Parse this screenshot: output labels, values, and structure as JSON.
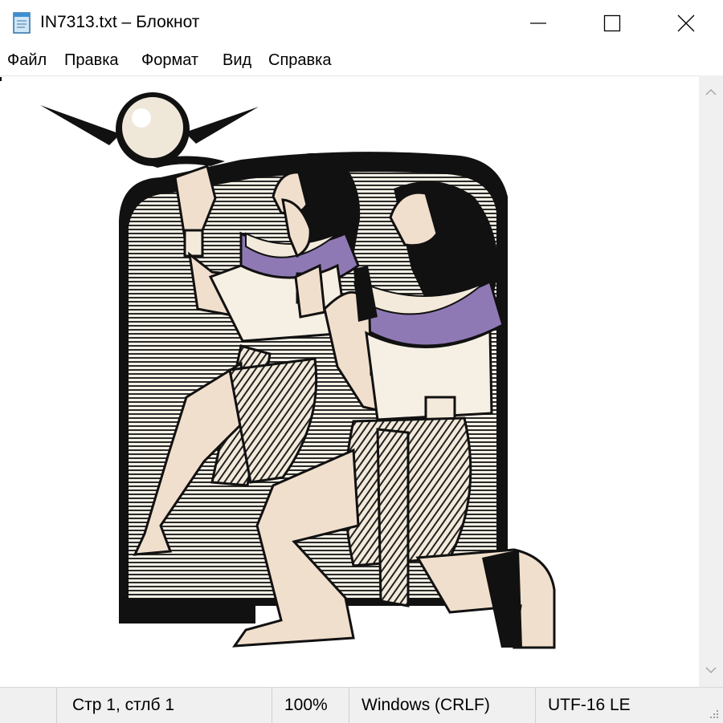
{
  "window": {
    "title": "IN7313.txt – Блокнот",
    "icon": "notepad-icon",
    "controls": [
      "minimize-icon",
      "maximize-icon",
      "close-icon"
    ]
  },
  "menu": {
    "items": [
      "Файл",
      "Правка",
      "Формат",
      "Вид",
      "Справка"
    ]
  },
  "document": {
    "content_image": "egyptian-figures-clipart"
  },
  "status": {
    "position": "Стр 1, стлб 1",
    "zoom": "100%",
    "line_endings": "Windows (CRLF)",
    "encoding": "UTF-16 LE"
  },
  "colors": {
    "accent_purple": "#8f79b5",
    "skin": "#f1dfcd",
    "line_art": "#111111"
  }
}
